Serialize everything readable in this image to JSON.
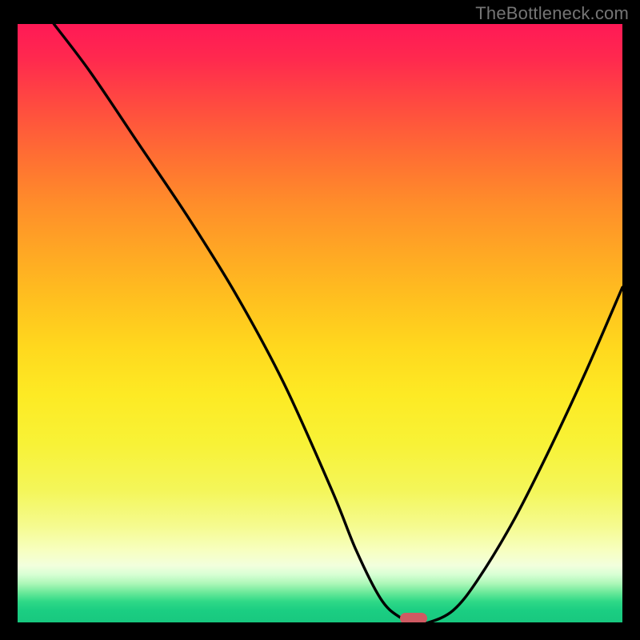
{
  "watermark": "TheBottleneck.com",
  "colors": {
    "marker": "#cf5a62",
    "stroke": "#000000"
  },
  "gradient_stops": [
    {
      "pct": 0,
      "color": "#ff1956"
    },
    {
      "pct": 6,
      "color": "#ff2a4e"
    },
    {
      "pct": 14,
      "color": "#ff4d3f"
    },
    {
      "pct": 22,
      "color": "#ff6e33"
    },
    {
      "pct": 30,
      "color": "#ff8d2a"
    },
    {
      "pct": 38,
      "color": "#ffa724"
    },
    {
      "pct": 46,
      "color": "#ffc01f"
    },
    {
      "pct": 54,
      "color": "#ffd81e"
    },
    {
      "pct": 62,
      "color": "#fdea24"
    },
    {
      "pct": 70,
      "color": "#f8f236"
    },
    {
      "pct": 78,
      "color": "#f4f65a"
    },
    {
      "pct": 84,
      "color": "#f5fb90"
    },
    {
      "pct": 88,
      "color": "#f7ffc0"
    },
    {
      "pct": 90.5,
      "color": "#f2ffdd"
    },
    {
      "pct": 92,
      "color": "#d7ffd4"
    },
    {
      "pct": 93.5,
      "color": "#adf7b8"
    },
    {
      "pct": 95,
      "color": "#6be99a"
    },
    {
      "pct": 96.5,
      "color": "#2fd987"
    },
    {
      "pct": 98,
      "color": "#1bce82"
    },
    {
      "pct": 100,
      "color": "#18c87f"
    }
  ],
  "chart_data": {
    "type": "line",
    "title": "",
    "xlabel": "",
    "ylabel": "",
    "xlim": [
      0,
      100
    ],
    "ylim": [
      0,
      100
    ],
    "series": [
      {
        "name": "bottleneck-curve",
        "x": [
          6,
          12,
          20,
          28,
          36,
          44,
          52,
          56,
          60,
          63,
          66,
          68,
          72,
          76,
          82,
          88,
          94,
          100
        ],
        "y": [
          100,
          92,
          80,
          68,
          55,
          40,
          22,
          12,
          4,
          1,
          0,
          0,
          2,
          7,
          17,
          29,
          42,
          56
        ]
      }
    ],
    "marker": {
      "x_center": 65.5,
      "x_width": 4.5,
      "y": 0
    }
  }
}
